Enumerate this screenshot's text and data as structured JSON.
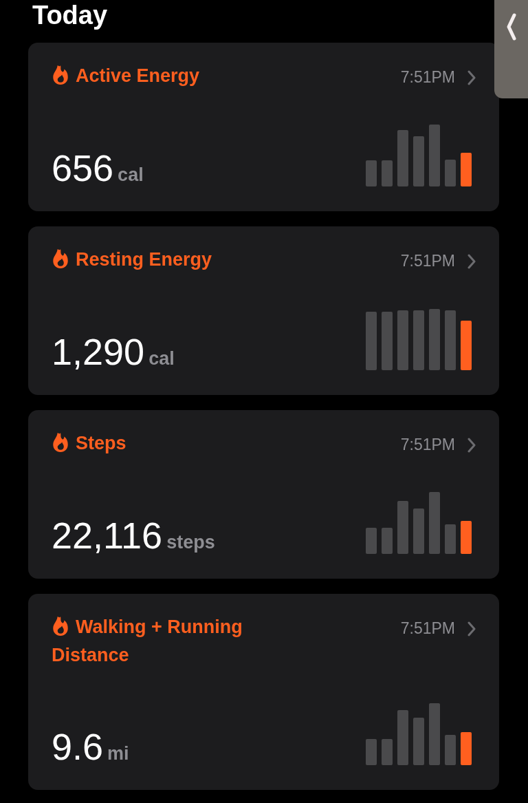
{
  "heading": "Today",
  "cards": [
    {
      "title": "Active Energy",
      "time": "7:51PM",
      "value": "656",
      "unit": "cal"
    },
    {
      "title": "Resting Energy",
      "time": "7:51PM",
      "value": "1,290",
      "unit": "cal"
    },
    {
      "title": "Steps",
      "time": "7:51PM",
      "value": "22,116",
      "unit": "steps"
    },
    {
      "title": "Walking + Running Distance",
      "time": "7:51PM",
      "value": "9.6",
      "unit": "mi"
    }
  ]
}
